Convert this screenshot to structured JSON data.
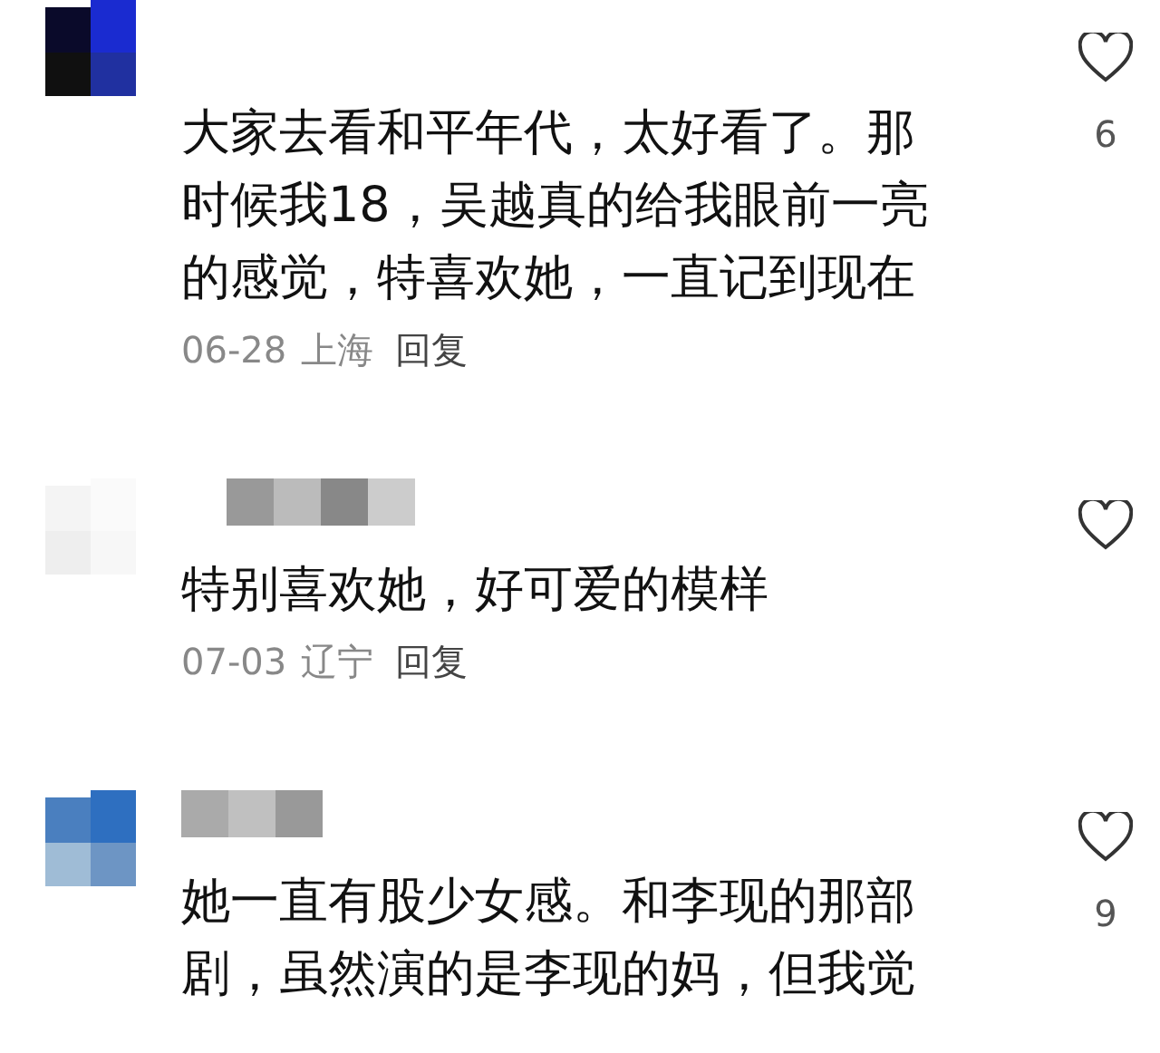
{
  "comments": [
    {
      "text": "大家去看和平年代，太好看了。那时候我18，吴越真的给我眼前一亮的感觉，特喜欢她，一直记到现在",
      "date": "06-28",
      "location": "上海",
      "reply": "回复",
      "likes": "6"
    },
    {
      "username": {
        "kind": "blurred"
      },
      "text": "特别喜欢她，好可爱的模样",
      "date": "07-03",
      "location": "辽宁",
      "reply": "回复"
    },
    {
      "username": {
        "kind": "blurred"
      },
      "text": "她一直有股少女感。和李现的那部剧，虽然演的是李现的妈，但我觉",
      "likes": "9"
    }
  ]
}
